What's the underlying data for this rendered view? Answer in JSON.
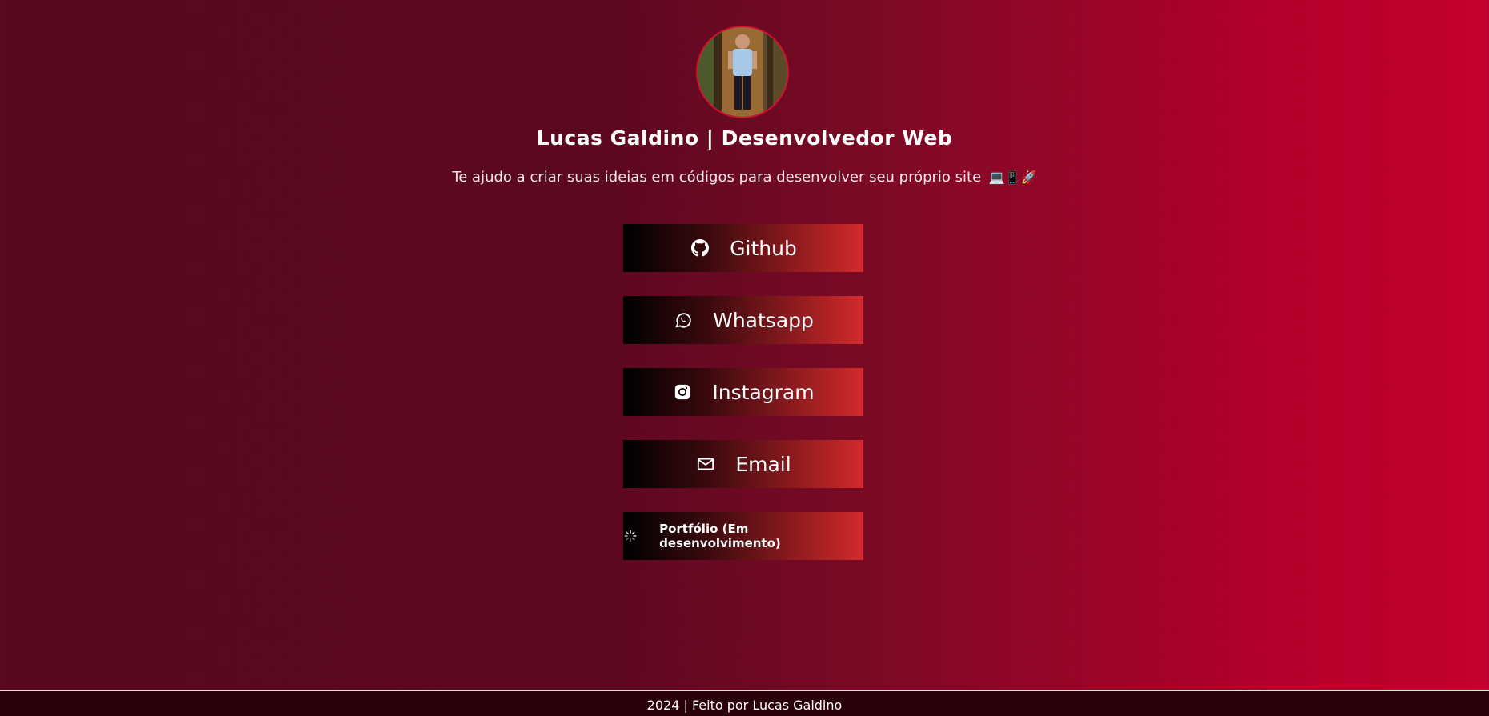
{
  "profile": {
    "name": "Lucas Galdino | Desenvolvedor Web",
    "bio": "Te ajudo a criar suas ideias em códigos para desenvolver seu próprio site",
    "bio_emojis": "💻📱🚀"
  },
  "links": [
    {
      "label": "Github",
      "icon": "github-icon"
    },
    {
      "label": "Whatsapp",
      "icon": "whatsapp-icon"
    },
    {
      "label": "Instagram",
      "icon": "instagram-icon"
    },
    {
      "label": "Email",
      "icon": "email-icon"
    },
    {
      "label": "Portfólio (Em desenvolvimento)",
      "icon": "loading-spinner-icon"
    }
  ],
  "footer": {
    "text": "2024 | Feito por Lucas Galdino"
  },
  "colors": {
    "background_start": "#5a0820",
    "background_end": "#c4002e",
    "button_start": "#000000",
    "button_end": "#d22a2a",
    "footer_bg": "#2a0009"
  }
}
